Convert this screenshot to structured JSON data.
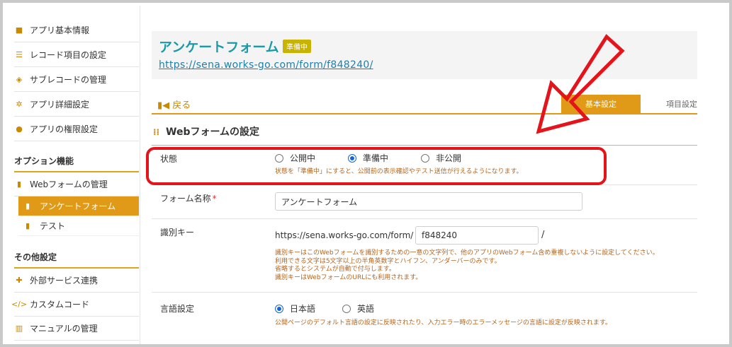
{
  "sidebar": {
    "items_top": [
      {
        "label": "アプリ基本情報",
        "icon": "info-icon"
      },
      {
        "label": "レコード項目の設定",
        "icon": "list-icon"
      },
      {
        "label": "サブレコードの管理",
        "icon": "layers-icon"
      },
      {
        "label": "アプリ詳細設定",
        "icon": "gear-icon"
      },
      {
        "label": "アプリの権限設定",
        "icon": "users-icon"
      }
    ],
    "heading_options": "オプション機能",
    "webform_manage": "Webフォームの管理",
    "sub_items": [
      {
        "label": "アンケートフォーム",
        "active": true
      },
      {
        "label": "テスト",
        "active": false
      }
    ],
    "heading_other": "その他設定",
    "items_bottom": [
      {
        "label": "外部サービス連携",
        "icon": "puzzle-icon"
      },
      {
        "label": "カスタムコード",
        "icon": "code-icon"
      },
      {
        "label": "マニュアルの管理",
        "icon": "book-icon"
      }
    ]
  },
  "header": {
    "title": "アンケートフォーム",
    "status_badge": "準備中",
    "url": "https://sena.works-go.com/form/f848240/"
  },
  "tabs": {
    "back": "戻る",
    "active": "基本設定",
    "inactive": "項目設定"
  },
  "section_title": "Webフォームの設定",
  "status_row": {
    "label": "状態",
    "options": [
      "公開中",
      "準備中",
      "非公開"
    ],
    "selected": "準備中",
    "help": "状態を「準備中」にすると、公開前の表示確認やテスト送信が行えるようになります。"
  },
  "name_row": {
    "label": "フォーム名称",
    "required_mark": "*",
    "value": "アンケートフォーム"
  },
  "key_row": {
    "label": "識別キー",
    "prefix": "https://sena.works-go.com/form/",
    "value": "f848240",
    "suffix": "/",
    "help": [
      "識別キーはこのWebフォームを識別するための一意の文字列で、他のアプリのWebフォーム含め重複しないように設定してください。",
      "利用できる文字は5文字以上の半角英数字とハイフン、アンダーバーのみです。",
      "省略するとシステムが自動で付与します。",
      "識別キーはWebフォームのURLにも利用されます。"
    ]
  },
  "lang_row": {
    "label": "言語設定",
    "options": [
      "日本語",
      "英語"
    ],
    "selected": "日本語",
    "help": "公開ページのデフォルト言語の設定に反映されたり、入力エラー時のエラーメッセージの言語に設定が反映されます。"
  },
  "colors": {
    "accent": "#e09a17",
    "title": "#1b9aa9",
    "annotation": "#e4141b"
  }
}
